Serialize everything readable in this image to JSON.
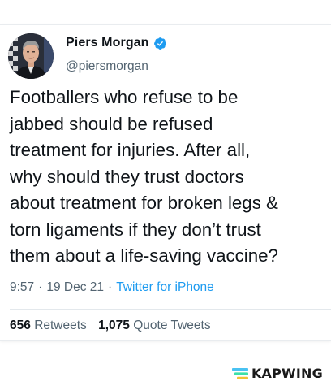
{
  "tweet": {
    "author_name": "Piers Morgan",
    "author_handle": "@piersmorgan",
    "verified": true,
    "text": "Footballers who refuse to be\njabbed should be refused\ntreatment for injuries. After all,\nwhy should they trust doctors\nabout treatment for broken legs &\ntorn ligaments if they don’t trust\nthem about a life-saving vaccine?",
    "time": "9:57",
    "date": "19 Dec 21",
    "separator": "·",
    "source": "Twitter for iPhone",
    "retweets_count": "656",
    "retweets_label": "Retweets",
    "quotes_count": "1,075",
    "quotes_label": "Quote Tweets"
  },
  "watermark": {
    "text": "KAPWING",
    "icon": "kapwing-logo-icon"
  },
  "colors": {
    "text_primary": "#0f1419",
    "text_secondary": "#536471",
    "link_blue": "#1d9bf0",
    "verified_blue": "#1d9bf0"
  }
}
